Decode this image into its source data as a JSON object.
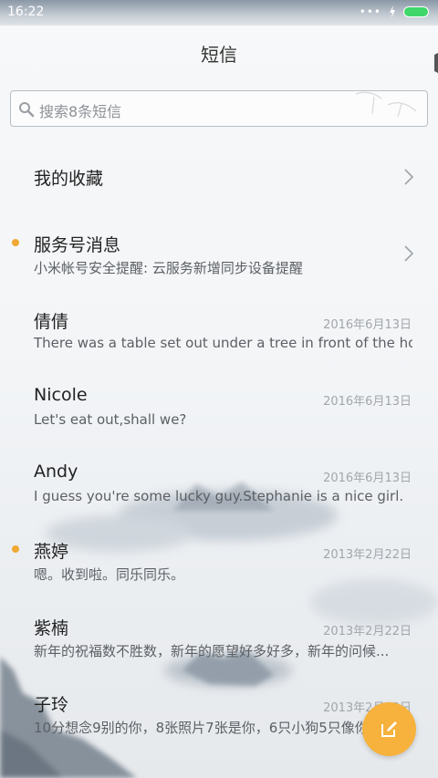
{
  "status_bar": {
    "time": "16:22",
    "dots": "•••"
  },
  "header": {
    "title": "短信"
  },
  "search": {
    "placeholder": "搜索8条短信"
  },
  "favorites": {
    "label": "我的收藏"
  },
  "service": {
    "name": "服务号消息",
    "preview": "小米帐号安全提醒: 云服务新增同步设备提醒",
    "unread": true
  },
  "conversations": [
    {
      "name": "倩倩",
      "date": "2016年6月13日",
      "preview": "There was a table set out under a tree in front of the ho...",
      "unread": false
    },
    {
      "name": "Nicole",
      "date": "2016年6月13日",
      "preview": "Let's eat out,shall we?",
      "unread": false
    },
    {
      "name": "Andy",
      "date": "2016年6月13日",
      "preview": "I guess you're some lucky guy.Stephanie is a nice girl.",
      "unread": false
    },
    {
      "name": "燕婷",
      "date": "2013年2月22日",
      "preview": "嗯。收到啦。同乐同乐。",
      "unread": true
    },
    {
      "name": "紫楠",
      "date": "2013年2月22日",
      "preview": "新年的祝福数不胜数，新年的愿望好多好多，新年的问候...",
      "unread": false
    },
    {
      "name": "子玲",
      "date": "2013年2月22日",
      "preview": "10分想念9别的你，8张照片7张是你，6只小狗5只像你",
      "unread": false
    }
  ],
  "icons": {
    "search": "search-icon",
    "chevron": "chevron-right-icon",
    "compose": "compose-icon",
    "unread": "unread-dot-icon",
    "charging": "charging-icon",
    "battery": "battery-icon"
  },
  "colors": {
    "accent": "#f6b23c",
    "unread_dot": "#f0a934",
    "battery": "#3fd66a"
  }
}
